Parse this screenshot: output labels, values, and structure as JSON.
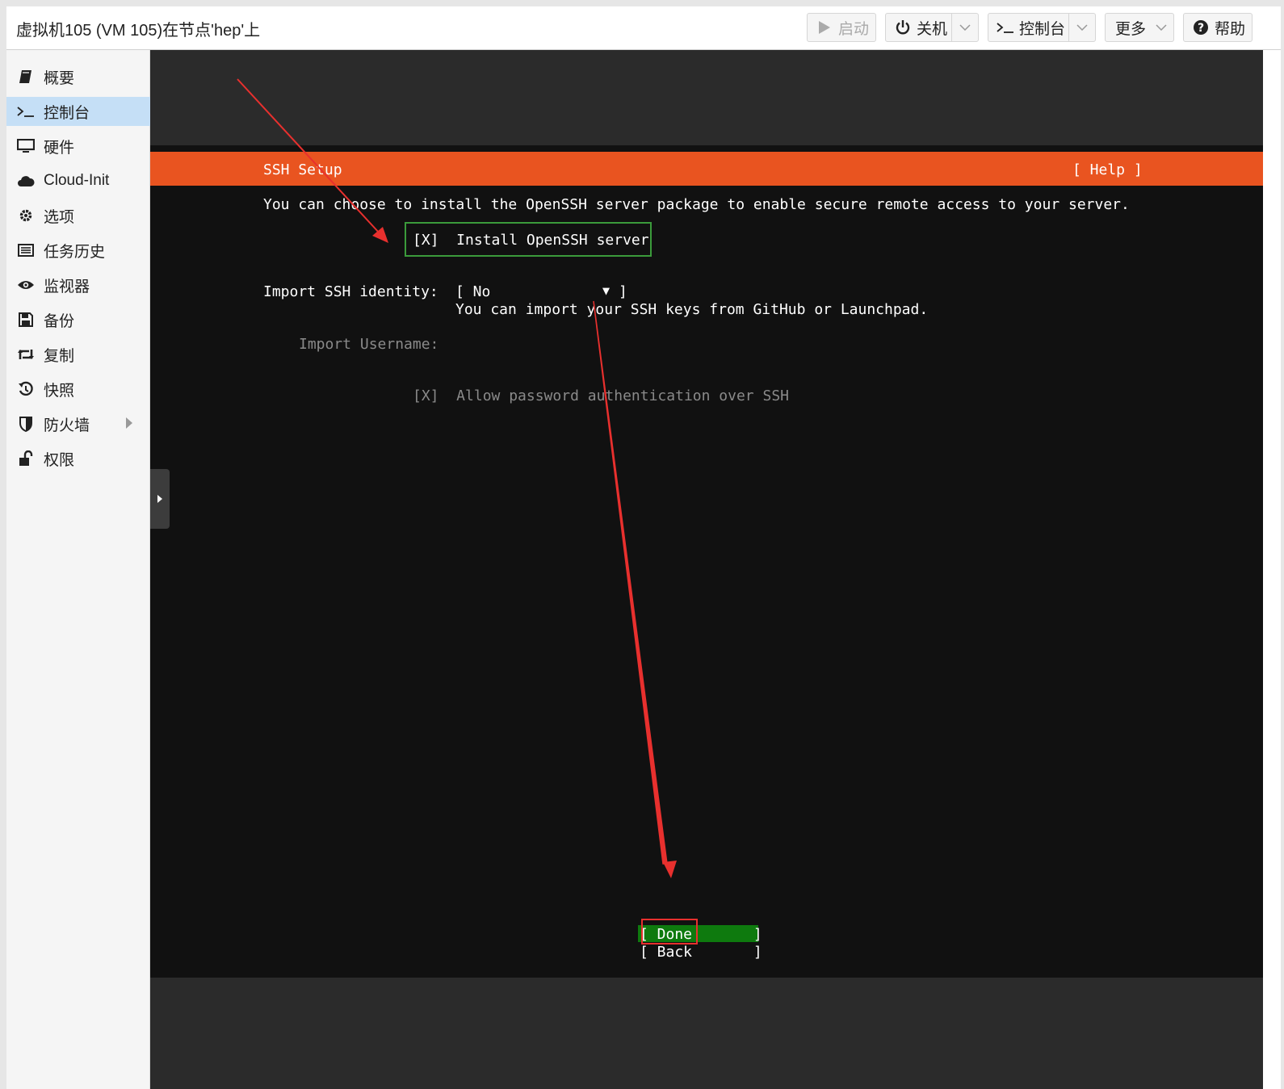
{
  "header": {
    "title": "虚拟机105 (VM 105)在节点'hep'上",
    "buttons": {
      "start_label": "启动",
      "shutdown_label": "关机",
      "console_label": "控制台",
      "more_label": "更多",
      "help_label": "帮助"
    }
  },
  "sidebar": {
    "items": [
      {
        "label": "概要",
        "icon": "book-icon"
      },
      {
        "label": "控制台",
        "icon": "terminal-icon",
        "active": true
      },
      {
        "label": "硬件",
        "icon": "monitor-icon"
      },
      {
        "label": "Cloud-Init",
        "icon": "cloud-icon"
      },
      {
        "label": "选项",
        "icon": "gear-icon"
      },
      {
        "label": "任务历史",
        "icon": "list-icon"
      },
      {
        "label": "监视器",
        "icon": "eye-icon"
      },
      {
        "label": "备份",
        "icon": "floppy-icon"
      },
      {
        "label": "复制",
        "icon": "retweet-icon"
      },
      {
        "label": "快照",
        "icon": "history-icon"
      },
      {
        "label": "防火墙",
        "icon": "shield-icon",
        "has_submenu": true
      },
      {
        "label": "权限",
        "icon": "unlock-icon"
      }
    ]
  },
  "terminal": {
    "title": "SSH Setup",
    "help": "[ Help ]",
    "description": "You can choose to install the OpenSSH server package to enable secure remote access to your server.",
    "install_checkbox": "[X]  Install OpenSSH server",
    "identity_label": "Import SSH identity:",
    "identity_value": "[ No",
    "identity_caret": "▼",
    "identity_close": "]",
    "identity_hint": "You can import your SSH keys from GitHub or Launchpad.",
    "username_label": "Import Username:",
    "allow_password": "[X]  Allow password authentication over SSH",
    "done_button": "[ Done       ]",
    "back_button": "[ Back       ]"
  },
  "colors": {
    "accent_orange": "#e95420",
    "terminal_bg": "#111111",
    "done_green": "#0e7a0e",
    "annotation_red": "#e8302e",
    "sidebar_active": "#c5dff6"
  }
}
